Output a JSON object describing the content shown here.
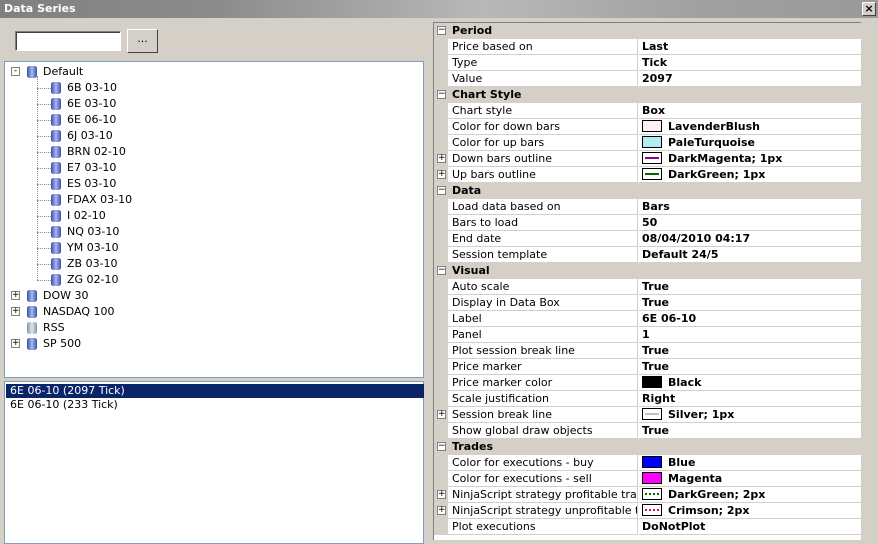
{
  "window": {
    "title": "Data Series",
    "close_label": "×"
  },
  "search": {
    "value": "",
    "button_label": "..."
  },
  "tree": {
    "default_label": "Default",
    "default_children": [
      "6B 03-10",
      "6E 03-10",
      "6E 06-10",
      "6J 03-10",
      "BRN 02-10",
      "E7 03-10",
      "ES 03-10",
      "FDAX 03-10",
      "I 02-10",
      "NQ 03-10",
      "YM 03-10",
      "ZB 03-10",
      "ZG 02-10"
    ],
    "other_nodes": [
      "DOW 30",
      "NASDAQ 100",
      "RSS",
      "SP 500"
    ]
  },
  "series_list": {
    "items": [
      "6E 06-10 (2097 Tick)",
      "6E 06-10 (233 Tick)"
    ],
    "selected_index": 0
  },
  "properties": {
    "categories": [
      {
        "name": "Period",
        "rows": [
          {
            "name": "Price based on",
            "value": "Last"
          },
          {
            "name": "Type",
            "value": "Tick"
          },
          {
            "name": "Value",
            "value": "2097"
          }
        ]
      },
      {
        "name": "Chart Style",
        "rows": [
          {
            "name": "Chart style",
            "value": "Box"
          },
          {
            "name": "Color for down bars",
            "value": "LavenderBlush",
            "swatch": "#fff0f5"
          },
          {
            "name": "Color for up bars",
            "value": "PaleTurquoise",
            "swatch": "#afeeee"
          },
          {
            "name": "Down bars outline",
            "value": "DarkMagenta; 1px",
            "line": "#8b008b",
            "expandable": true
          },
          {
            "name": "Up bars outline",
            "value": "DarkGreen; 1px",
            "line": "#006400",
            "expandable": true
          }
        ]
      },
      {
        "name": "Data",
        "rows": [
          {
            "name": "Load data based on",
            "value": "Bars"
          },
          {
            "name": "Bars to load",
            "value": "50"
          },
          {
            "name": "End date",
            "value": "08/04/2010 04:17"
          },
          {
            "name": "Session template",
            "value": "Default 24/5"
          }
        ]
      },
      {
        "name": "Visual",
        "rows": [
          {
            "name": "Auto scale",
            "value": "True"
          },
          {
            "name": "Display in Data Box",
            "value": "True"
          },
          {
            "name": "Label",
            "value": "6E 06-10"
          },
          {
            "name": "Panel",
            "value": "1"
          },
          {
            "name": "Plot session break line",
            "value": "True"
          },
          {
            "name": "Price marker",
            "value": "True"
          },
          {
            "name": "Price marker color",
            "value": "Black",
            "swatch": "#000000"
          },
          {
            "name": "Scale justification",
            "value": "Right"
          },
          {
            "name": "Session break line",
            "value": "Silver; 1px",
            "line": "#c0c0c0",
            "expandable": true
          },
          {
            "name": "Show global draw objects",
            "value": "True"
          }
        ]
      },
      {
        "name": "Trades",
        "rows": [
          {
            "name": "Color for executions - buy",
            "value": "Blue",
            "swatch": "#0000ff"
          },
          {
            "name": "Color for executions - sell",
            "value": "Magenta",
            "swatch": "#ff00ff"
          },
          {
            "name": "NinjaScript strategy profitable trade line",
            "value": "DarkGreen; 2px",
            "line": "#006400",
            "dotted": true,
            "expandable": true
          },
          {
            "name": "NinjaScript strategy unprofitable trade line",
            "value": "Crimson; 2px",
            "line": "#dc143c",
            "dotted": true,
            "expandable": true
          },
          {
            "name": "Plot executions",
            "value": "DoNotPlot"
          }
        ]
      }
    ]
  }
}
